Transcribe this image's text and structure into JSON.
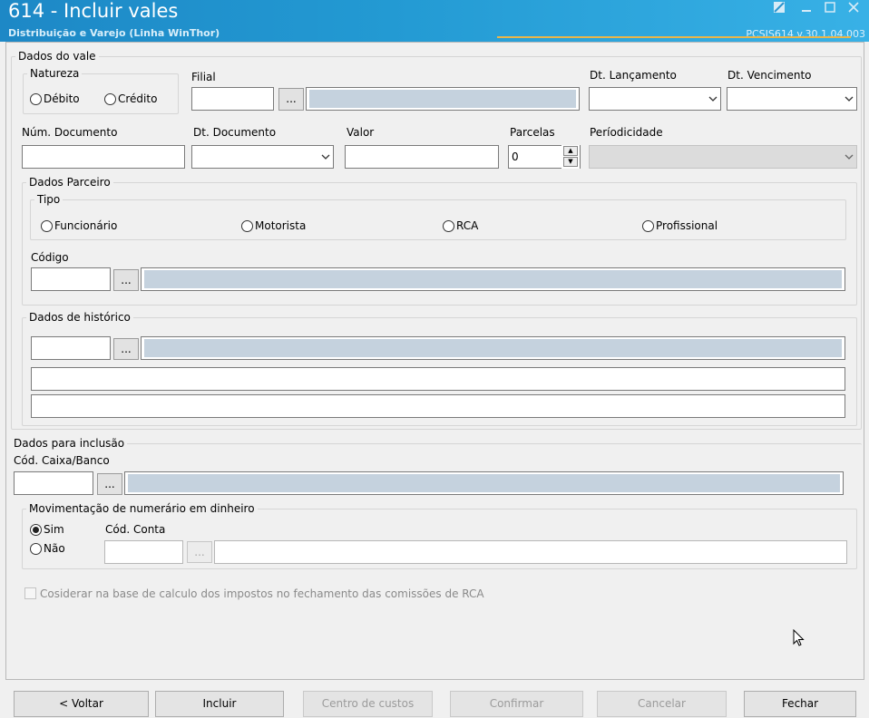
{
  "window": {
    "title": "614 - Incluir vales",
    "subtitle": "Distribuição e Varejo (Linha WinThor)",
    "version": "PCSIS614  v.30.1.04.003"
  },
  "dados_vale": {
    "legend": "Dados do vale",
    "natureza": {
      "legend": "Natureza",
      "options": [
        "Débito",
        "Crédito"
      ]
    },
    "filial_label": "Filial",
    "dt_lancamento_label": "Dt. Lançamento",
    "dt_vencimento_label": "Dt. Vencimento",
    "num_documento_label": "Núm. Documento",
    "dt_documento_label": "Dt. Documento",
    "valor_label": "Valor",
    "parcelas_label": "Parcelas",
    "parcelas_value": "0",
    "periodicidade_label": "Períodicidade",
    "browse_label": "..."
  },
  "parceiro": {
    "legend": "Dados Parceiro",
    "tipo_legend": "Tipo",
    "tipos": [
      "Funcionário",
      "Motorista",
      "RCA",
      "Profissional"
    ],
    "codigo_label": "Código"
  },
  "historico": {
    "legend": "Dados de histórico"
  },
  "inclusao": {
    "legend": "Dados para inclusão",
    "caixa_label": "Cód. Caixa/Banco",
    "movimentacao": {
      "legend": "Movimentação de numerário em dinheiro",
      "options": [
        "Sim",
        "Não"
      ],
      "selected": "Sim",
      "conta_label": "Cód. Conta"
    }
  },
  "checkbox_label": "Cosiderar na base de calculo dos impostos no fechamento das comissões de RCA",
  "footer": {
    "voltar": "< Voltar",
    "incluir": "Incluir",
    "centro": "Centro de custos",
    "confirmar": "Confirmar",
    "cancelar": "Cancelar",
    "fechar": "Fechar"
  }
}
